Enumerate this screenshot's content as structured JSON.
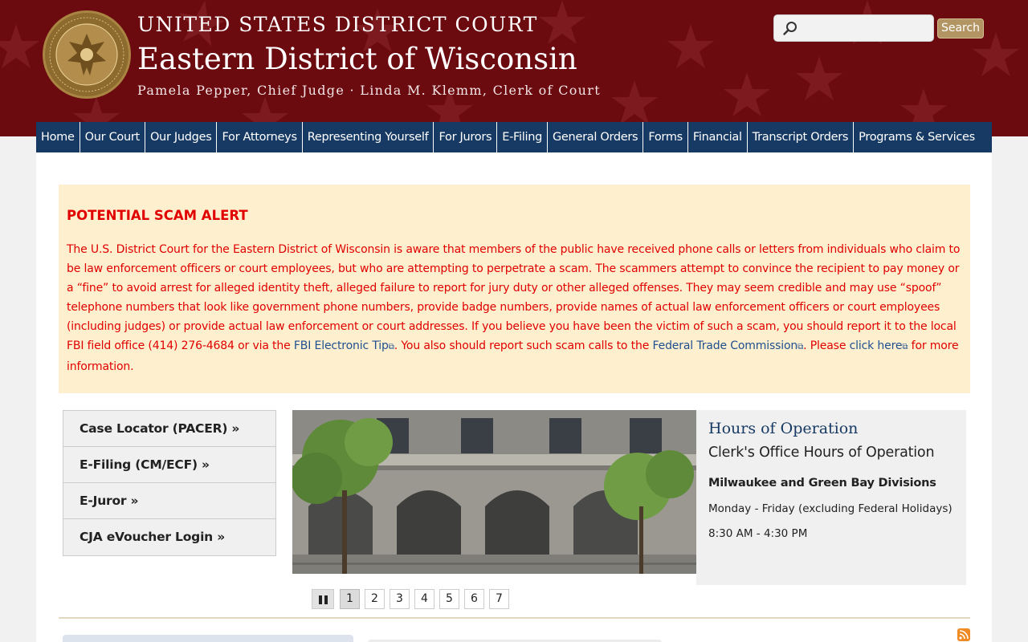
{
  "header": {
    "line1": "UNITED STATES DISTRICT COURT",
    "line2": "Eastern District of Wisconsin",
    "line3": "Pamela Pepper, Chief Judge · Linda M. Klemm, Clerk of Court",
    "seal_text_top": "UNITED STATES DISTRICT COURT",
    "seal_text_bottom": "EASTERN DISTRICT OF WISCONSIN",
    "colors": {
      "background": "#6b0a0f",
      "accent": "#b39563"
    }
  },
  "search": {
    "placeholder": "",
    "value": "",
    "button_label": "Search"
  },
  "nav": {
    "items": [
      {
        "label": "Home"
      },
      {
        "label": "Our Court"
      },
      {
        "label": "Our Judges"
      },
      {
        "label": "For Attorneys"
      },
      {
        "label": "Representing Yourself"
      },
      {
        "label": "For Jurors"
      },
      {
        "label": "E-Filing"
      },
      {
        "label": "General Orders"
      },
      {
        "label": "Forms"
      },
      {
        "label": "Financial"
      },
      {
        "label": "Transcript Orders"
      },
      {
        "label": "Programs & Services"
      }
    ]
  },
  "alert": {
    "title": "POTENTIAL SCAM ALERT",
    "text_1": "The U.S. District Court for the Eastern District of Wisconsin is aware that members of the public have received phone calls or letters from individuals who claim to be law enforcement officers or court employees, but who are attempting to perpetrate a scam. The scammers attempt to convince the recipient to pay money or a “fine” to avoid arrest for alleged identity theft, alleged failure to report for jury duty or other alleged offenses. They may seem credible and may use “spoof” telephone numbers that look like government phone numbers, provide badge numbers, provide names of actual law enforcement officers or court employees (including judges) or provide actual law enforcement or court addresses. If you believe you have been the victim of such a scam, you should report it to the local FBI field office (414) 276-4684 or via the ",
    "link_fbi": "FBI Electronic Tip",
    "text_2": ". You also should report such scam calls to the ",
    "link_ftc": "Federal Trade Commission",
    "text_3": ". Please ",
    "link_click": "click here",
    "text_4": " for more information."
  },
  "quick_links": [
    {
      "label": "Case Locator (PACER) »"
    },
    {
      "label": "E-Filing (CM/ECF) »"
    },
    {
      "label": "E-Juror »"
    },
    {
      "label": "CJA eVoucher Login »"
    }
  ],
  "hours": {
    "title": "Hours of Operation",
    "subtitle": "Clerk's Office Hours of Operation",
    "divisions": "Milwaukee and Green Bay Divisions",
    "days": "Monday - Friday (excluding Federal Holidays)",
    "time": "8:30 AM - 4:30 PM"
  },
  "pager": {
    "pages": [
      "1",
      "2",
      "3",
      "4",
      "5",
      "6",
      "7"
    ],
    "active": "1"
  }
}
